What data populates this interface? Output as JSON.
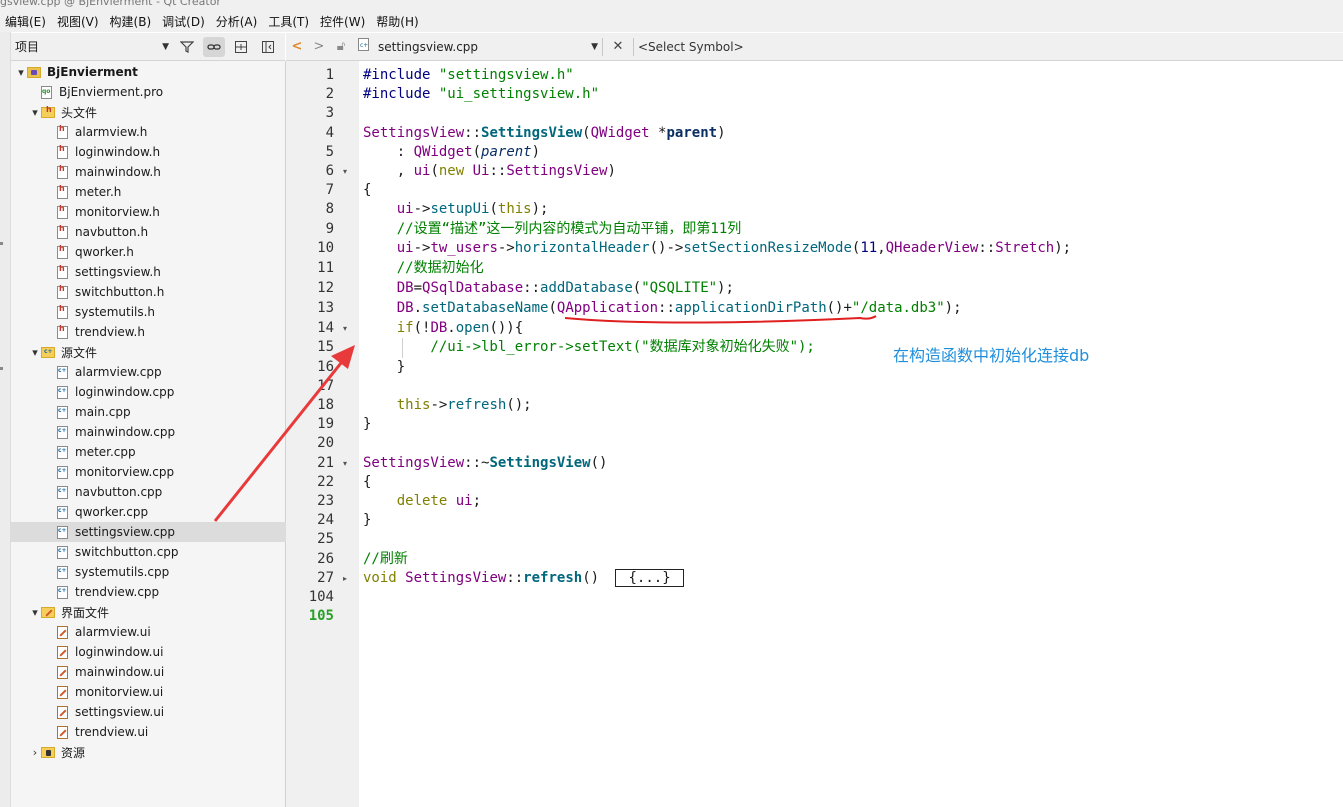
{
  "window": {
    "title": "gsview.cpp @ BjEnvierment - Qt Creator"
  },
  "menu": [
    "编辑(E)",
    "视图(V)",
    "构建(B)",
    "调试(D)",
    "分析(A)",
    "工具(T)",
    "控件(W)",
    "帮助(H)"
  ],
  "project_panel": {
    "selector": "项目",
    "tree": [
      {
        "label": "BjEnvierment",
        "level": 0,
        "kind": "project",
        "expanded": true
      },
      {
        "label": "BjEnvierment.pro",
        "level": 1,
        "kind": "pro"
      },
      {
        "label": "头文件",
        "level": 1,
        "kind": "folder-h",
        "expanded": true
      },
      {
        "label": "alarmview.h",
        "level": 2,
        "kind": "h"
      },
      {
        "label": "loginwindow.h",
        "level": 2,
        "kind": "h"
      },
      {
        "label": "mainwindow.h",
        "level": 2,
        "kind": "h"
      },
      {
        "label": "meter.h",
        "level": 2,
        "kind": "h"
      },
      {
        "label": "monitorview.h",
        "level": 2,
        "kind": "h"
      },
      {
        "label": "navbutton.h",
        "level": 2,
        "kind": "h"
      },
      {
        "label": "qworker.h",
        "level": 2,
        "kind": "h"
      },
      {
        "label": "settingsview.h",
        "level": 2,
        "kind": "h"
      },
      {
        "label": "switchbutton.h",
        "level": 2,
        "kind": "h"
      },
      {
        "label": "systemutils.h",
        "level": 2,
        "kind": "h"
      },
      {
        "label": "trendview.h",
        "level": 2,
        "kind": "h"
      },
      {
        "label": "源文件",
        "level": 1,
        "kind": "folder-c",
        "expanded": true
      },
      {
        "label": "alarmview.cpp",
        "level": 2,
        "kind": "c"
      },
      {
        "label": "loginwindow.cpp",
        "level": 2,
        "kind": "c"
      },
      {
        "label": "main.cpp",
        "level": 2,
        "kind": "c"
      },
      {
        "label": "mainwindow.cpp",
        "level": 2,
        "kind": "c"
      },
      {
        "label": "meter.cpp",
        "level": 2,
        "kind": "c"
      },
      {
        "label": "monitorview.cpp",
        "level": 2,
        "kind": "c"
      },
      {
        "label": "navbutton.cpp",
        "level": 2,
        "kind": "c"
      },
      {
        "label": "qworker.cpp",
        "level": 2,
        "kind": "c"
      },
      {
        "label": "settingsview.cpp",
        "level": 2,
        "kind": "c",
        "selected": true
      },
      {
        "label": "switchbutton.cpp",
        "level": 2,
        "kind": "c"
      },
      {
        "label": "systemutils.cpp",
        "level": 2,
        "kind": "c"
      },
      {
        "label": "trendview.cpp",
        "level": 2,
        "kind": "c"
      },
      {
        "label": "界面文件",
        "level": 1,
        "kind": "folder-ui",
        "expanded": true
      },
      {
        "label": "alarmview.ui",
        "level": 2,
        "kind": "ui"
      },
      {
        "label": "loginwindow.ui",
        "level": 2,
        "kind": "ui"
      },
      {
        "label": "mainwindow.ui",
        "level": 2,
        "kind": "ui"
      },
      {
        "label": "monitorview.ui",
        "level": 2,
        "kind": "ui"
      },
      {
        "label": "settingsview.ui",
        "level": 2,
        "kind": "ui"
      },
      {
        "label": "trendview.ui",
        "level": 2,
        "kind": "ui"
      },
      {
        "label": "资源",
        "level": 1,
        "kind": "folder-res",
        "expanded": false
      }
    ]
  },
  "editor": {
    "filename": "settingsview.cpp",
    "symbol_placeholder": "<Select Symbol>",
    "current_line": "105",
    "lines": [
      {
        "n": "1",
        "fold": "",
        "segs": [
          [
            "pp",
            "#include "
          ],
          [
            "str",
            "\"settingsview.h\""
          ]
        ]
      },
      {
        "n": "2",
        "fold": "",
        "segs": [
          [
            "pp",
            "#include "
          ],
          [
            "str",
            "\"ui_settingsview.h\""
          ]
        ]
      },
      {
        "n": "3",
        "fold": "",
        "segs": []
      },
      {
        "n": "4",
        "fold": "",
        "segs": [
          [
            "typ",
            "SettingsView"
          ],
          [
            "",
            "::"
          ],
          [
            "fbold",
            "SettingsView"
          ],
          [
            "",
            "("
          ],
          [
            "typ",
            "QWidget"
          ],
          [
            "",
            " *"
          ],
          [
            "fbold2",
            "parent"
          ],
          [
            "",
            ")"
          ]
        ]
      },
      {
        "n": "5",
        "fold": "",
        "segs": [
          [
            "",
            "    : "
          ],
          [
            "typ",
            "QWidget"
          ],
          [
            "",
            "("
          ],
          [
            "par",
            "parent"
          ],
          [
            "",
            ")"
          ]
        ]
      },
      {
        "n": "6",
        "fold": "▾",
        "segs": [
          [
            "",
            "    , "
          ],
          [
            "typ",
            "ui"
          ],
          [
            "",
            "("
          ],
          [
            "kw",
            "new"
          ],
          [
            "",
            " "
          ],
          [
            "typ",
            "Ui"
          ],
          [
            "",
            "::"
          ],
          [
            "typ",
            "SettingsView"
          ],
          [
            "",
            ")"
          ]
        ]
      },
      {
        "n": "7",
        "fold": "",
        "segs": [
          [
            "",
            "{"
          ]
        ]
      },
      {
        "n": "8",
        "fold": "",
        "segs": [
          [
            "",
            "    "
          ],
          [
            "typ",
            "ui"
          ],
          [
            "",
            "->"
          ],
          [
            "fn",
            "setupUi"
          ],
          [
            "",
            "("
          ],
          [
            "kw",
            "this"
          ],
          [
            "",
            ");"
          ]
        ]
      },
      {
        "n": "9",
        "fold": "",
        "segs": [
          [
            "cm",
            "    //设置“描述”这一列内容的模式为自动平铺，即第11列"
          ]
        ]
      },
      {
        "n": "10",
        "fold": "",
        "segs": [
          [
            "",
            "    "
          ],
          [
            "typ",
            "ui"
          ],
          [
            "",
            "->"
          ],
          [
            "typ",
            "tw_users"
          ],
          [
            "",
            "->"
          ],
          [
            "fn",
            "horizontalHeader"
          ],
          [
            "",
            "()->"
          ],
          [
            "fn",
            "setSectionResizeMode"
          ],
          [
            "",
            "("
          ],
          [
            "num",
            "11"
          ],
          [
            "",
            ","
          ],
          [
            "typ",
            "QHeaderView"
          ],
          [
            "",
            "::"
          ],
          [
            "typ",
            "Stretch"
          ],
          [
            "",
            ");"
          ]
        ]
      },
      {
        "n": "11",
        "fold": "",
        "segs": [
          [
            "cm",
            "    //数据初始化"
          ]
        ]
      },
      {
        "n": "12",
        "fold": "",
        "segs": [
          [
            "",
            "    "
          ],
          [
            "typ",
            "DB"
          ],
          [
            "",
            "="
          ],
          [
            "typ",
            "QSqlDatabase"
          ],
          [
            "",
            "::"
          ],
          [
            "fn",
            "addDatabase"
          ],
          [
            "",
            "("
          ],
          [
            "str",
            "\"QSQLITE\""
          ],
          [
            "",
            ");"
          ]
        ]
      },
      {
        "n": "13",
        "fold": "",
        "segs": [
          [
            "",
            "    "
          ],
          [
            "typ",
            "DB"
          ],
          [
            "",
            "."
          ],
          [
            "fn",
            "setDatabaseName"
          ],
          [
            "",
            "("
          ],
          [
            "typ",
            "QApplication"
          ],
          [
            "",
            "::"
          ],
          [
            "fn",
            "applicationDirPath"
          ],
          [
            "",
            "()+"
          ],
          [
            "str",
            "\"/data.db3\""
          ],
          [
            "",
            ");"
          ]
        ]
      },
      {
        "n": "14",
        "fold": "▾",
        "segs": [
          [
            "",
            "    "
          ],
          [
            "kw",
            "if"
          ],
          [
            "",
            "(!"
          ],
          [
            "typ",
            "DB"
          ],
          [
            "",
            "."
          ],
          [
            "fn",
            "open"
          ],
          [
            "",
            "()){"
          ]
        ]
      },
      {
        "n": "15",
        "fold": "",
        "segs": [
          [
            "cm",
            "        //ui->lbl_error->setText(\"数据库对象初始化失败\");"
          ]
        ]
      },
      {
        "n": "16",
        "fold": "",
        "segs": [
          [
            "",
            "    }"
          ]
        ]
      },
      {
        "n": "17",
        "fold": "",
        "segs": []
      },
      {
        "n": "18",
        "fold": "",
        "segs": [
          [
            "",
            "    "
          ],
          [
            "kw",
            "this"
          ],
          [
            "",
            "->"
          ],
          [
            "fn",
            "refresh"
          ],
          [
            "",
            "();"
          ]
        ]
      },
      {
        "n": "19",
        "fold": "",
        "segs": [
          [
            "",
            "}"
          ]
        ]
      },
      {
        "n": "20",
        "fold": "",
        "segs": []
      },
      {
        "n": "21",
        "fold": "▾",
        "segs": [
          [
            "typ",
            "SettingsView"
          ],
          [
            "",
            "::~"
          ],
          [
            "fbold",
            "SettingsView"
          ],
          [
            "",
            "()"
          ]
        ]
      },
      {
        "n": "22",
        "fold": "",
        "segs": [
          [
            "",
            "{"
          ]
        ]
      },
      {
        "n": "23",
        "fold": "",
        "segs": [
          [
            "",
            "    "
          ],
          [
            "kw",
            "delete"
          ],
          [
            "",
            " "
          ],
          [
            "typ",
            "ui"
          ],
          [
            "",
            ";"
          ]
        ]
      },
      {
        "n": "24",
        "fold": "",
        "segs": [
          [
            "",
            "}"
          ]
        ]
      },
      {
        "n": "25",
        "fold": "",
        "segs": []
      },
      {
        "n": "26",
        "fold": "",
        "segs": [
          [
            "cm",
            "//刷新"
          ]
        ]
      },
      {
        "n": "27",
        "fold": "▸",
        "segs": [
          [
            "kw",
            "void"
          ],
          [
            "",
            " "
          ],
          [
            "typ",
            "SettingsView"
          ],
          [
            "",
            "::"
          ],
          [
            "fbold",
            "refresh"
          ],
          [
            "",
            "() "
          ],
          [
            "box",
            "{...}"
          ]
        ]
      },
      {
        "n": "104",
        "fold": "",
        "segs": []
      },
      {
        "n": "105",
        "fold": "",
        "segs": []
      }
    ]
  },
  "annotation": {
    "text": "在构造函数中初始化连接db",
    "color": "#1f8fdc"
  },
  "colors": {
    "arrow": "#e83a3a",
    "underline": "#e02020"
  }
}
